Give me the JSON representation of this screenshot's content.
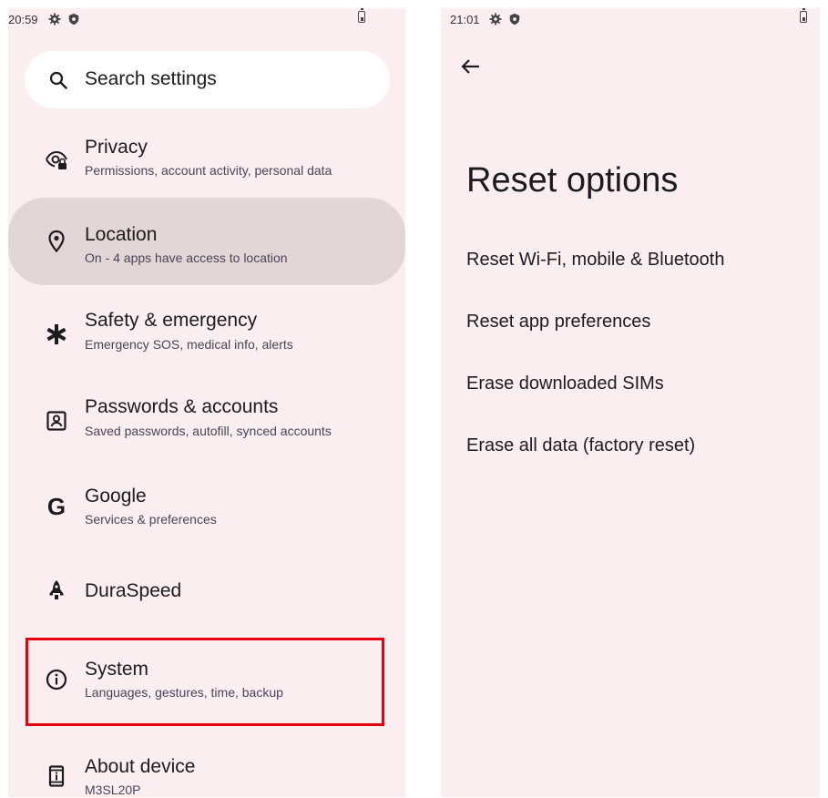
{
  "left_screen": {
    "status": {
      "time": "20:59"
    },
    "search": {
      "placeholder": "Search settings"
    },
    "items": [
      {
        "title": "Privacy",
        "subtitle": "Permissions, account activity, personal data",
        "icon": "privacy-eye-lock-icon"
      },
      {
        "title": "Location",
        "subtitle": "On - 4 apps have access to location",
        "icon": "location-pin-icon",
        "selected": true
      },
      {
        "title": "Safety & emergency",
        "subtitle": "Emergency SOS, medical info, alerts",
        "icon": "asterisk-icon"
      },
      {
        "title": "Passwords & accounts",
        "subtitle": "Saved passwords, autofill, synced accounts",
        "icon": "account-box-icon"
      },
      {
        "title": "Google",
        "subtitle": "Services & preferences",
        "icon": "google-g-icon"
      },
      {
        "title": "DuraSpeed",
        "subtitle": "",
        "icon": "rocket-icon"
      },
      {
        "title": "System",
        "subtitle": "Languages, gestures, time, backup",
        "icon": "info-circle-icon",
        "highlighted": true
      },
      {
        "title": "About device",
        "subtitle": "M3SL20P",
        "icon": "device-info-icon"
      }
    ]
  },
  "right_screen": {
    "status": {
      "time": "21:01"
    },
    "title": "Reset options",
    "options": [
      "Reset Wi-Fi, mobile & Bluetooth",
      "Reset app preferences",
      "Erase downloaded SIMs",
      "Erase all data (factory reset)"
    ]
  },
  "colors": {
    "screen_background": "#fbeef0",
    "selected_item_background": "#e2d6d6",
    "highlight_border": "#e8000a"
  }
}
